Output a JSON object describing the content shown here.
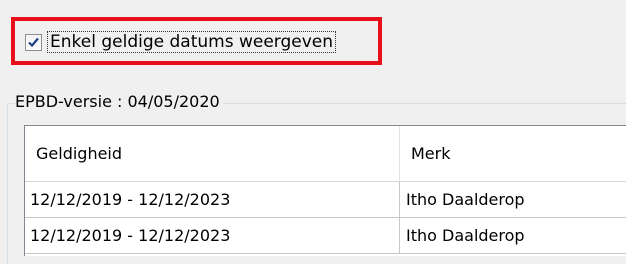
{
  "filter": {
    "checkbox_label": "Enkel geldige datums weergeven",
    "checked": true
  },
  "group": {
    "legend": "EPBD-versie : 04/05/2020"
  },
  "table": {
    "columns": [
      "Geldigheid",
      "Merk"
    ],
    "rows": [
      [
        "12/12/2019 - 12/12/2023",
        "Itho Daalderop"
      ],
      [
        "12/12/2019 - 12/12/2023",
        "Itho Daalderop"
      ]
    ]
  },
  "colors": {
    "highlight": "#e8101a",
    "check_mark": "#1e3f86"
  }
}
